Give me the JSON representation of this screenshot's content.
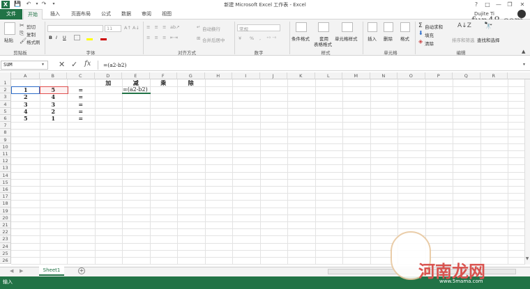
{
  "window": {
    "title": "新建 Microsoft Excel 工作表 - Excel",
    "user": "Dujite Ti",
    "watermark_top": "fun48.com",
    "help_label": "?"
  },
  "tabs": [
    "文件",
    "开始",
    "插入",
    "页面布局",
    "公式",
    "数据",
    "审阅",
    "视图"
  ],
  "ribbon": {
    "clipboard": {
      "paste": "粘贴",
      "cut": "剪切",
      "copy": "复制",
      "format_painter": "格式刷",
      "label": "剪贴板"
    },
    "font": {
      "size": "11",
      "label": "字体",
      "bold": "B",
      "italic": "I",
      "underline": "U"
    },
    "alignment": {
      "wrap": "自动换行",
      "merge": "合并后居中",
      "label": "对齐方式"
    },
    "number": {
      "format": "常规",
      "percent": "%",
      "comma": ",",
      "label": "数字"
    },
    "styles": {
      "conditional": "条件格式",
      "table_line1": "套用",
      "table_line2": "表格格式",
      "cell_styles": "单元格样式",
      "label": "样式"
    },
    "cells": {
      "insert": "插入",
      "delete": "删除",
      "format": "格式",
      "label": "单元格"
    },
    "editing": {
      "autosum": "自动求和",
      "fill": "填充",
      "clear": "清除",
      "sort": "排序和筛选",
      "find": "查找和选择",
      "label": "编辑"
    }
  },
  "formula_bar": {
    "name_box": "SUM",
    "fx": "fx",
    "formula": "=(a2-b2)"
  },
  "columns": [
    "A",
    "B",
    "C",
    "D",
    "E",
    "F",
    "G",
    "H",
    "I",
    "J",
    "K",
    "L",
    "M",
    "N",
    "O",
    "P",
    "Q",
    "R"
  ],
  "rows": [
    "1",
    "2",
    "3",
    "4",
    "5",
    "6",
    "7",
    "8",
    "9",
    "10",
    "11",
    "12",
    "13",
    "14",
    "15",
    "16",
    "17",
    "18",
    "19",
    "20",
    "21",
    "22",
    "23",
    "24",
    "25",
    "26"
  ],
  "cells": {
    "D1": "加",
    "E1": "减",
    "F1": "乘",
    "G1": "除",
    "A2": "1",
    "B2": "5",
    "C2": "=",
    "A3": "2",
    "B3": "4",
    "C3": "=",
    "A4": "3",
    "B4": "3",
    "C4": "=",
    "A5": "4",
    "B5": "2",
    "C5": "=",
    "A6": "5",
    "B6": "1",
    "C6": "=",
    "E2": "=(a2-b2)"
  },
  "sheet_tabs": {
    "active": "Sheet1",
    "add": "+"
  },
  "status": {
    "mode": "输入"
  },
  "watermark": {
    "text": "河南龙网",
    "url": "www.5mama.com"
  },
  "colors": {
    "accent": "#217346",
    "selection_red": "#e05050",
    "selection_blue": "#2a6ac8"
  }
}
